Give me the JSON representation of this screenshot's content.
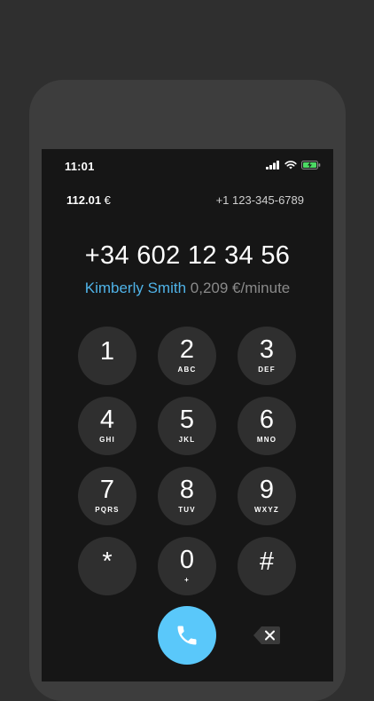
{
  "status": {
    "time": "11:01"
  },
  "account": {
    "balance": "112.01",
    "currency": "€",
    "own_number": "+1 123-345-6789"
  },
  "dialer": {
    "number": "+34 602 12 34 56",
    "contact_name": "Kimberly Smith",
    "rate": "0,209 €/minute"
  },
  "keypad": [
    {
      "digit": "1",
      "letters": ""
    },
    {
      "digit": "2",
      "letters": "ABC"
    },
    {
      "digit": "3",
      "letters": "DEF"
    },
    {
      "digit": "4",
      "letters": "GHI"
    },
    {
      "digit": "5",
      "letters": "JKL"
    },
    {
      "digit": "6",
      "letters": "MNO"
    },
    {
      "digit": "7",
      "letters": "PQRS"
    },
    {
      "digit": "8",
      "letters": "TUV"
    },
    {
      "digit": "9",
      "letters": "WXYZ"
    },
    {
      "digit": "*",
      "letters": ""
    },
    {
      "digit": "0",
      "letters": "+"
    },
    {
      "digit": "#",
      "letters": ""
    }
  ],
  "icons": {
    "call": "phone-icon",
    "delete": "backspace-icon",
    "signal": "cellular-signal-icon",
    "wifi": "wifi-icon",
    "battery": "battery-charging-icon"
  },
  "colors": {
    "accent": "#5ac8fa",
    "contact": "#4fb3e8",
    "battery": "#4cd964"
  }
}
